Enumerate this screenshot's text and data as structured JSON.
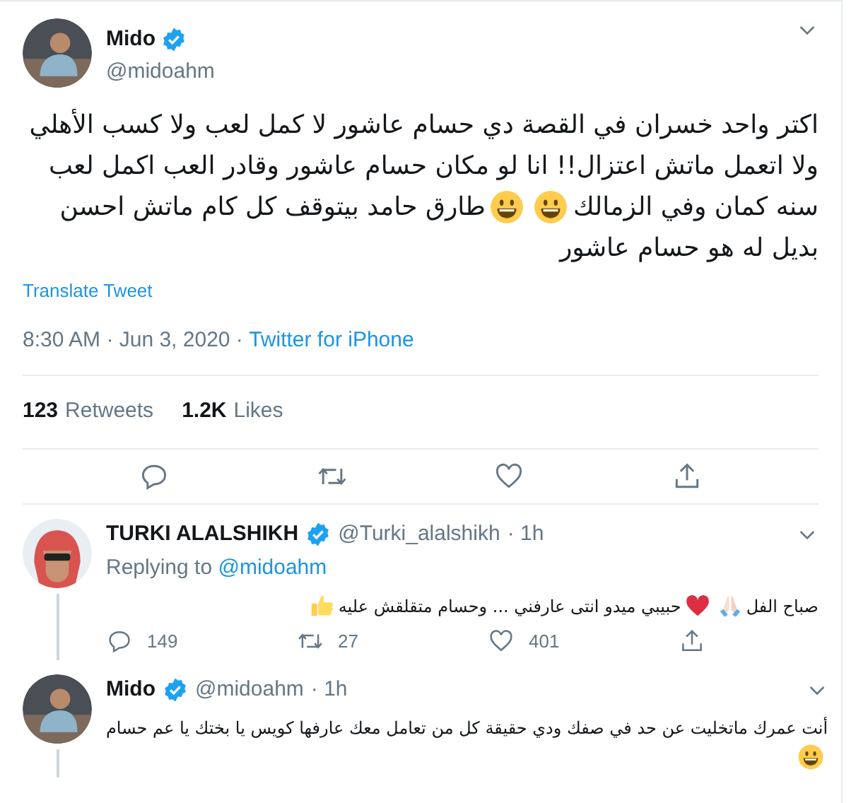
{
  "tweet": {
    "name": "Mido",
    "verified": true,
    "handle": "@midoahm",
    "body": [
      [
        {
          "kind": "text",
          "text": "اكتر واحد خسران في القصة دي حسام عاشور لا كمل لعب ولا كسب الأهلي"
        }
      ],
      [
        {
          "kind": "text",
          "text": "ولا اتعمل ماتش اعتزال!! انا لو مكان حسام عاشور وقادر العب اكمل لعب"
        }
      ],
      [
        {
          "kind": "text",
          "text": "سنه كمان وفي الزمالك"
        },
        {
          "kind": "smiley"
        },
        {
          "kind": "smiley"
        },
        {
          "kind": "text",
          "text": "طارق حامد بيتوقف كل كام ماتش احسن"
        }
      ],
      [
        {
          "kind": "text",
          "text": "بديل له هو حسام عاشور"
        }
      ]
    ],
    "translate": "Translate Tweet",
    "time": "8:30 AM · Jun 3, 2020 · ",
    "source": "Twitter for iPhone",
    "stats": [
      {
        "count": "123",
        "label": "Retweets"
      },
      {
        "count": "1.2K",
        "label": "Likes"
      }
    ]
  },
  "replies": [
    {
      "name": "TURKI ALALSHIKH",
      "verified": true,
      "handle": "@Turki_alalshikh",
      "time": "· 1h",
      "replying_label": "Replying to ",
      "replying_to": "@midoahm",
      "body": [
        [
          {
            "kind": "text",
            "text": "صباح الفل"
          },
          {
            "kind": "pray"
          },
          {
            "kind": "heart"
          },
          {
            "kind": "text",
            "text": "حبيبي ميدو انتى عارفني ... وحسام متقلقش عليه"
          },
          {
            "kind": "thumbs"
          }
        ]
      ],
      "actions": {
        "replies": "149",
        "retweets": "27",
        "likes": "401"
      }
    },
    {
      "name": "Mido",
      "verified": true,
      "handle": "@midoahm",
      "time": "· 1h",
      "body": [
        [
          {
            "kind": "text",
            "text": "أنت عمرك ماتخليت عن حد في صفك ودي حقيقة كل من تعامل معك عارفها كويس يا بختك يا عم حسام"
          }
        ],
        [
          {
            "kind": "smiley"
          }
        ]
      ]
    }
  ]
}
